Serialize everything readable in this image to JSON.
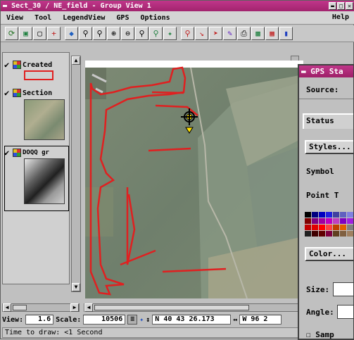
{
  "window": {
    "title": "Sect_30 / NE_field - Group View 1"
  },
  "menu": {
    "items": [
      "View",
      "Tool",
      "LegendView",
      "GPS",
      "Options"
    ],
    "help": "Help"
  },
  "legend": {
    "layers": [
      {
        "label": "Created"
      },
      {
        "label": "Section"
      },
      {
        "label": "DOQQ gr"
      }
    ]
  },
  "status": {
    "view_label": "View:",
    "view_value": "1.6",
    "scale_label": "Scale:",
    "scale_value": "10506",
    "lat": "N 40 43 26.173",
    "lon": "W 96 2",
    "time_to_draw": "Time to draw: <1 Second"
  },
  "gps_panel": {
    "title": "GPS Sta",
    "source_label": "Source: ",
    "status_tab": "Status",
    "styles_button": "Styles...",
    "symbol_label": "Symbol",
    "point_label": "Point T",
    "color_button": "Color...",
    "size_label": "Size:",
    "angle_label": "Angle:",
    "sample_label": "Samp"
  },
  "colors": {
    "title_bar": "#b02a7c",
    "field_outline": "#e02020",
    "gps_marker": "#ffe000"
  }
}
